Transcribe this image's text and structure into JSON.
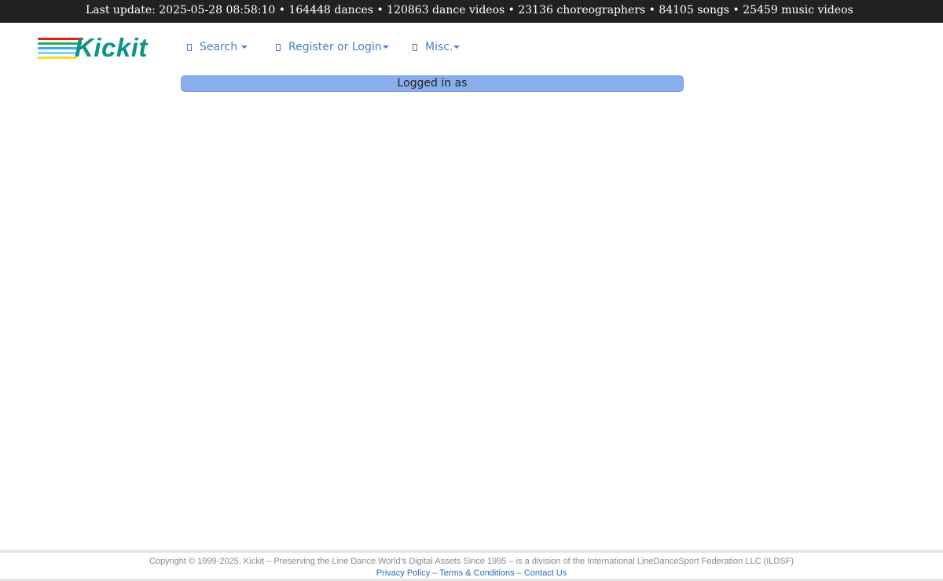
{
  "topbar": {
    "text": "Last update: 2025-05-28 08:58:10 • 164448 dances • 120863 dance videos • 23136 choreographers • 84105 songs • 25459 music videos"
  },
  "logo": {
    "text": "Kickit",
    "color": "#0d9488",
    "stripe_colors": [
      "#e02020",
      "#22b14c",
      "#3fa9f5",
      "#7fd3f7",
      "#f7e11b"
    ]
  },
  "nav": {
    "search_label": "Search",
    "register_label": "Register or Login",
    "misc_label": "Misc.",
    "link_color": "#4a7fc6"
  },
  "banner": {
    "text": "Logged in as",
    "color": "#8aadee"
  },
  "footer": {
    "copyright": "Copyright © 1999-2025.  Kickit – Preserving the Line Dance World's Digital Assets Since 1995 – is a division of the International LineDanceSport Federation LLC (ILDSF)",
    "privacy_label": "Privacy Policy",
    "terms_label": "Terms & Conditions",
    "contact_label": "Contact Us",
    "separator": " – "
  }
}
